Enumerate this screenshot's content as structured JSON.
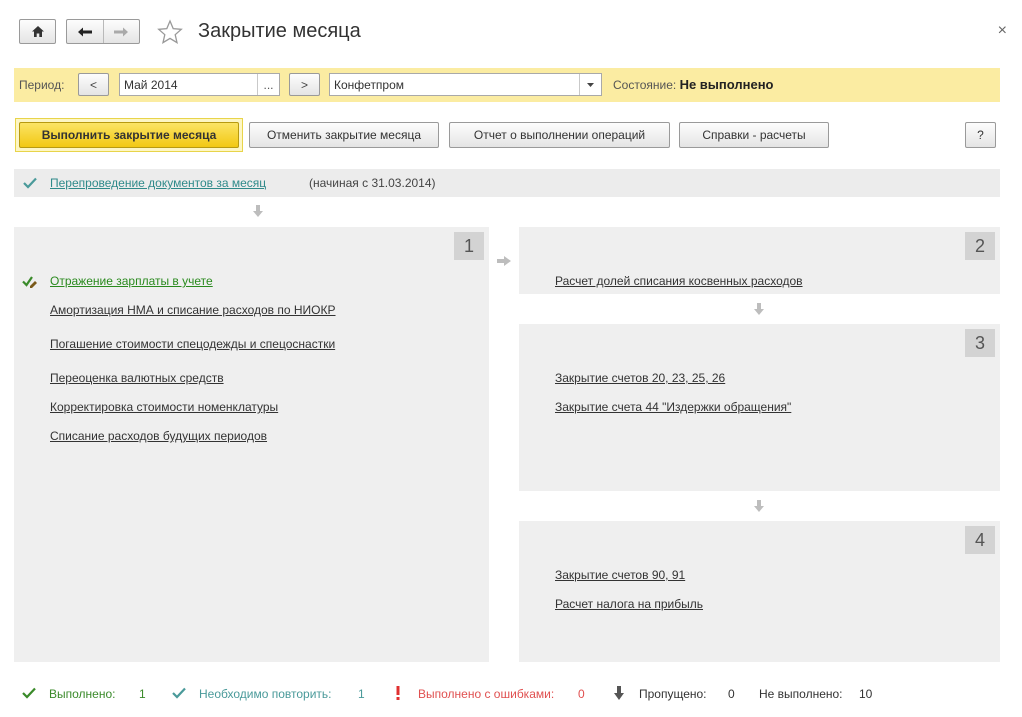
{
  "window": {
    "title": "Закрытие месяца",
    "close_glyph": "×"
  },
  "period": {
    "label": "Период:",
    "prev_label": "<",
    "next_label": ">",
    "value": "Май 2014",
    "select_label": "...",
    "organization": "Конфетпром",
    "state_label": "Состояние:",
    "state_value": "Не выполнено"
  },
  "actions": {
    "execute": "Выполнить закрытие месяца",
    "cancel": "Отменить закрытие месяца",
    "report": "Отчет о выполнении операций",
    "references": "Справки - расчеты",
    "help": "?"
  },
  "repost": {
    "link": "Перепроведение документов за месяц",
    "note": "(начиная с 31.03.2014)"
  },
  "stages": [
    {
      "number": "1",
      "operations": [
        {
          "label": "Отражение зарплаты в учете",
          "status": "done"
        },
        {
          "label": "Амортизация НМА и списание расходов по НИОКР",
          "status": "pending"
        },
        {
          "label": "Погашение стоимости спецодежды и спецоснастки",
          "status": "pending"
        },
        {
          "label": "Переоценка валютных средств",
          "status": "pending"
        },
        {
          "label": "Корректировка стоимости номенклатуры",
          "status": "pending"
        },
        {
          "label": "Списание расходов будущих периодов",
          "status": "pending"
        }
      ]
    },
    {
      "number": "2",
      "operations": [
        {
          "label": "Расчет долей списания косвенных расходов",
          "status": "pending"
        }
      ]
    },
    {
      "number": "3",
      "operations": [
        {
          "label": "Закрытие счетов 20, 23, 25, 26",
          "status": "pending"
        },
        {
          "label": "Закрытие счета 44 \"Издержки обращения\"",
          "status": "pending"
        }
      ]
    },
    {
      "number": "4",
      "operations": [
        {
          "label": "Закрытие счетов 90, 91",
          "status": "pending"
        },
        {
          "label": "Расчет налога на прибыль",
          "status": "pending"
        }
      ]
    }
  ],
  "status": {
    "done_label": "Выполнено:",
    "done_count": "1",
    "repeat_label": "Необходимо повторить:",
    "repeat_count": "1",
    "errors_label": "Выполнено с ошибками:",
    "errors_count": "0",
    "skipped_label": "Пропущено:",
    "skipped_count": "0",
    "not_done_label": "Не выполнено:",
    "not_done_count": "10"
  },
  "colors": {
    "period_bar": "#fbeca2",
    "primary_button": "#f2c812",
    "done_green": "#2a8a1e",
    "repeat_teal": "#4a9a9a",
    "error_red": "#e05050",
    "panel_bg": "#efefef"
  },
  "icons": {
    "home": "home-icon",
    "back": "arrow-left-icon",
    "forward": "arrow-right-icon",
    "favorite": "star-icon",
    "close": "close-icon",
    "dropdown": "chevron-down-icon",
    "done": "check-icon",
    "done_edit": "check-pencil-icon",
    "flow_down": "arrow-down-icon",
    "flow_right": "arrow-right-icon",
    "error": "exclamation-icon",
    "skipped": "arrow-down-icon"
  }
}
